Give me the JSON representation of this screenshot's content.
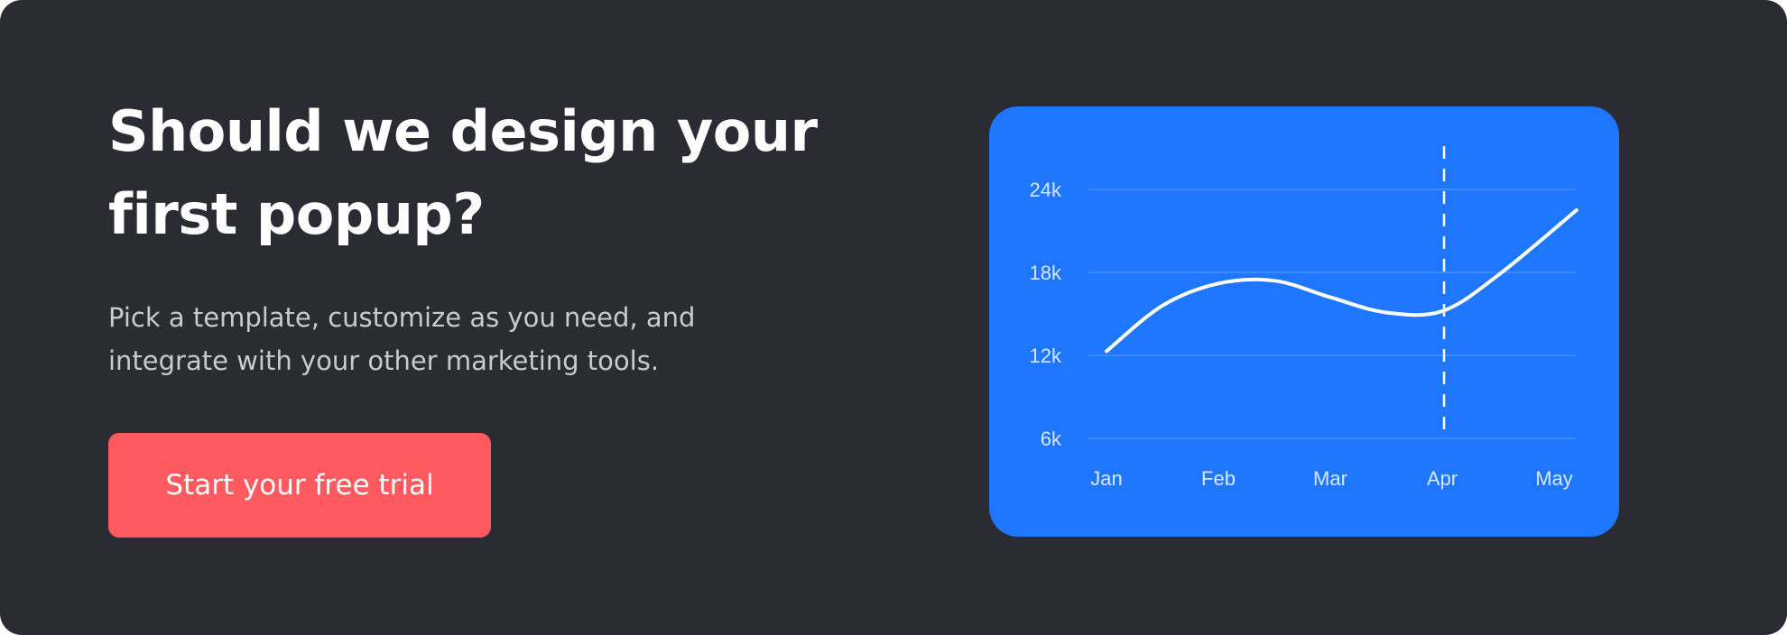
{
  "hero": {
    "headline_line1": "Should we design your",
    "headline_line2": "first popup?",
    "subtext_line1": "Pick a template, customize as you need, and",
    "subtext_line2": "integrate with your other marketing tools.",
    "cta_label": "Start your free trial"
  },
  "colors": {
    "background": "#2a2b33",
    "cta": "#ff5a5f",
    "chart_card": "#1f77ff",
    "line": "#ffffff"
  },
  "chart_data": {
    "type": "line",
    "categories": [
      "Jan",
      "Feb",
      "Mar",
      "Apr",
      "May"
    ],
    "series": [
      {
        "x": [
          0,
          0.5,
          1.0,
          1.5,
          2.0,
          2.5,
          3.0,
          3.5,
          4.2
        ],
        "values": [
          12.3,
          15.6,
          17.2,
          17.4,
          16.2,
          15.1,
          15.2,
          17.8,
          22.5
        ]
      }
    ],
    "y_ticks": [
      6,
      12,
      18,
      24
    ],
    "y_tick_labels": [
      "6k",
      "12k",
      "18k",
      "24k"
    ],
    "ylim": [
      6,
      24
    ],
    "highlight_category": "Apr",
    "grid": true
  }
}
